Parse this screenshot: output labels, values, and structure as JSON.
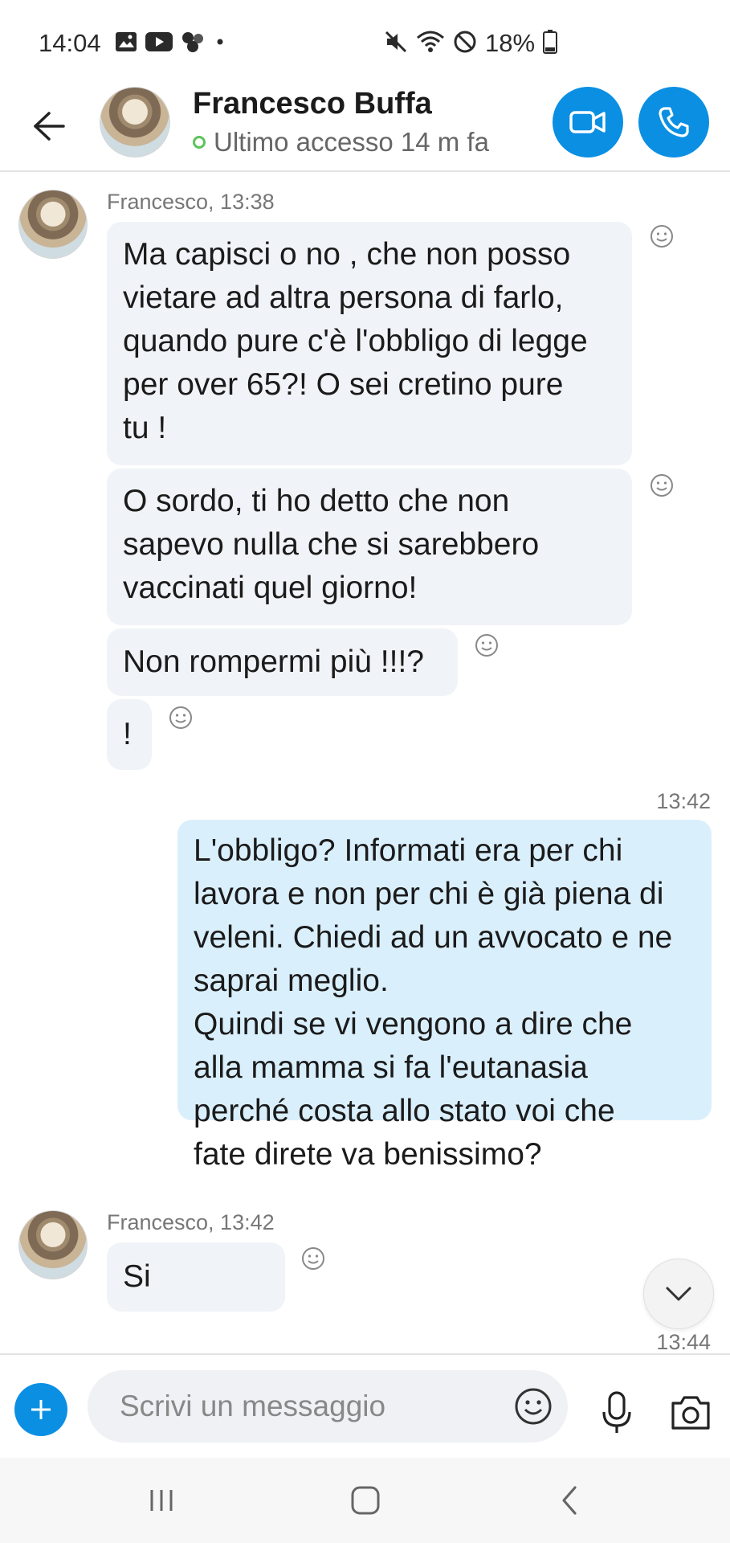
{
  "status_bar": {
    "time": "14:04",
    "battery": "18%",
    "icons_left": [
      "gallery-icon",
      "youtube-icon",
      "cluster-icon",
      "dot"
    ],
    "icons_right": [
      "mute-icon",
      "wifi-icon",
      "block-icon",
      "battery-icon"
    ]
  },
  "header": {
    "contact_name": "Francesco Buffa",
    "status_text": "Ultimo accesso 14 m fa",
    "presence_color": "#5cc45c",
    "accent": "#0a8fe3"
  },
  "messages": [
    {
      "meta": "Francesco, 13:38",
      "text_lines": [
        "Ma capisci o no , che non posso",
        "vietare ad altra persona di farlo,",
        "quando pure c'è l'obbligo di legge",
        "per over 65?! O sei cretino pure",
        "tu !"
      ]
    },
    {
      "text_lines": [
        "O sordo, ti ho detto che non",
        "sapevo nulla che si sarebbero",
        "vaccinati quel giorno!"
      ]
    },
    {
      "text_lines": [
        "Non rompermi più !!!?"
      ]
    },
    {
      "text_lines": [
        "!"
      ]
    },
    {
      "time": "13:42",
      "text_lines": [
        "L'obbligo? Informati era per chi",
        "lavora e non per chi è già piena di",
        "veleni. Chiedi ad un avvocato e ne",
        "saprai meglio.",
        "Quindi se vi vengono a dire che",
        "alla mamma si fa l'eutanasia",
        "perché costa allo stato voi che",
        "fate direte va benissimo?"
      ]
    },
    {
      "meta": "Francesco, 13:42",
      "text_lines": [
        "Si"
      ]
    },
    {
      "time": "13:44"
    }
  ],
  "composer": {
    "placeholder": "Scrivi un messaggio"
  }
}
